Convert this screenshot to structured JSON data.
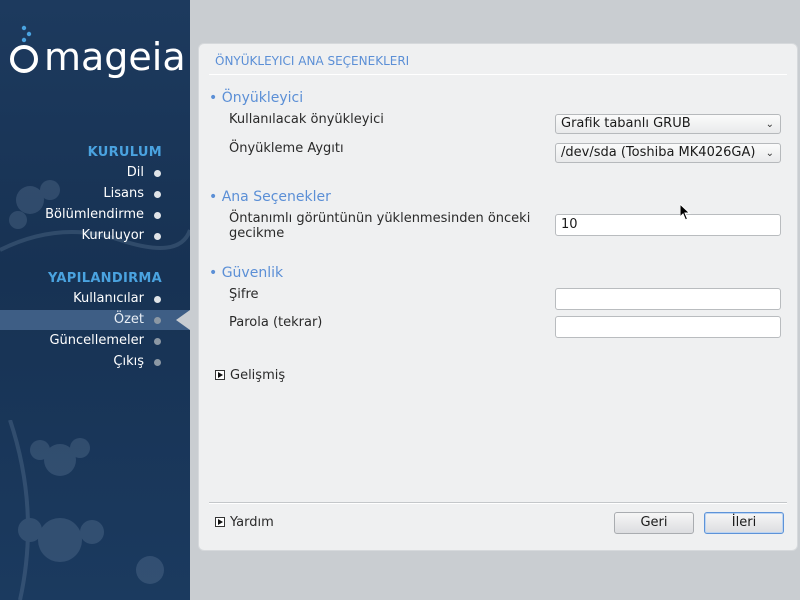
{
  "brand": {
    "name": "mageia",
    "color": "#ffffff",
    "accent": "#4aa3e0"
  },
  "sidebar": {
    "section1": "KURULUM",
    "section1_items": [
      "Dil",
      "Lisans",
      "Bölümlendirme",
      "Kuruluyor"
    ],
    "section2": "YAPILANDIRMA",
    "section2_items": [
      "Kullanıcılar",
      "Özet",
      "Güncellemeler",
      "Çıkış"
    ],
    "active_item": "Özet"
  },
  "panel": {
    "title": "ÖNYÜKLEYICI ANA SEÇENEKLERI",
    "bootloader": {
      "heading": "• Önyükleyici",
      "use_label": "Kullanılacak önyükleyici",
      "use_value": "Grafik tabanlı GRUB",
      "device_label": "Önyükleme Aygıtı",
      "device_value": "/dev/sda (Toshiba MK4026GA)"
    },
    "main_options": {
      "heading": "• Ana Seçenekler",
      "delay_label_line1": "Öntanımlı görüntünün yüklenmesinden önceki",
      "delay_label_line2": "gecikme",
      "delay_value": "10"
    },
    "security": {
      "heading": "• Güvenlik",
      "password_label": "Şifre",
      "password_value": "",
      "password_repeat_label": "Parola (tekrar)",
      "password_repeat_value": ""
    },
    "advanced_label": "Gelişmiş",
    "help_label": "Yardım",
    "back_button": "Geri",
    "next_button": "İleri"
  },
  "colors": {
    "sidebar_bg": "#1b3a5f",
    "heading_blue": "#5b8fd6",
    "panel_bg": "#eff0f1"
  }
}
